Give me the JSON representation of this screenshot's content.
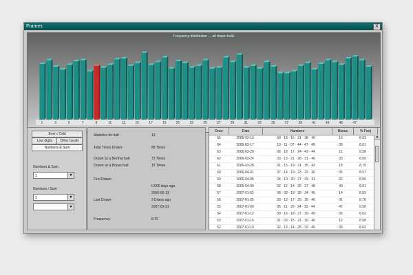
{
  "window": {
    "title": "Frames",
    "close_label": "X"
  },
  "chart_data": {
    "type": "bar",
    "title": "Frequency distribution — all drawn balls",
    "categories": [
      "1",
      "2",
      "3",
      "4",
      "5",
      "6",
      "7",
      "8",
      "9",
      "10",
      "11",
      "12",
      "13",
      "14",
      "15",
      "16",
      "17",
      "18",
      "19",
      "20",
      "21",
      "22",
      "23",
      "24",
      "25",
      "26",
      "27",
      "28",
      "29",
      "30",
      "31",
      "32",
      "33",
      "34",
      "35",
      "36",
      "37",
      "38",
      "39",
      "40",
      "41",
      "42",
      "43",
      "44",
      "45",
      "46",
      "47",
      "48",
      "49"
    ],
    "values": [
      60,
      64,
      57,
      54,
      59,
      63,
      64,
      52,
      58,
      56,
      59,
      65,
      66,
      58,
      61,
      72,
      59,
      62,
      67,
      55,
      63,
      61,
      56,
      58,
      64,
      55,
      56,
      67,
      62,
      70,
      56,
      58,
      55,
      62,
      57,
      50,
      50,
      52,
      58,
      61,
      54,
      60,
      64,
      62,
      59,
      66,
      68,
      64,
      57
    ],
    "highlight_index": 8,
    "highlight_color": "#c92a2a",
    "bar_color": "#1d8f87",
    "ylim": [
      0,
      80
    ],
    "tick_labels": [
      "1",
      "3",
      "5",
      "7",
      "9",
      "11",
      "13",
      "15",
      "17",
      "19",
      "21",
      "23",
      "25",
      "27",
      "29",
      "31",
      "33",
      "35",
      "37",
      "39",
      "41",
      "43",
      "45",
      "47"
    ]
  },
  "left_panel": {
    "mode_tabs": [
      "Even / Odd",
      "Low digits",
      "Other bands"
    ],
    "sub_tab": "Numbers & Sum",
    "group1_label": "Numbers & Sum",
    "group1_value": "1",
    "group2_label": "Numbers / Sum",
    "group2_value": "1",
    "group3_value": ""
  },
  "stats": {
    "rows": [
      {
        "label": "Statistics for ball:",
        "value": "13"
      },
      {
        "label": "Total Times Drawn:",
        "value": "88 Times"
      },
      {
        "label": "Drawn as a Normal ball:",
        "value": "73 Times"
      },
      {
        "label": "Drawn as a Bonus ball:",
        "value": "15 Times"
      },
      {
        "label": "First Drawn:",
        "value": ""
      },
      {
        "label": "",
        "value": "0.000 days ago"
      },
      {
        "label": "",
        "value": "2006-05-13"
      },
      {
        "label": "Last Drawn:",
        "value": "3 Draws ago"
      },
      {
        "label": "",
        "value": "2007-03-31"
      },
      {
        "label": "Frequency:",
        "value": "8.70"
      }
    ]
  },
  "table": {
    "headers": [
      "Draw",
      "Date",
      "Numbers",
      "Bonus",
      "% Freq"
    ],
    "rows": [
      [
        "65",
        "2006-03-13",
        "09 · 18 · 15 · 31 · 38 · 40",
        "13",
        "8.63"
      ],
      [
        "64",
        "2006-03-17",
        "10 · 11 · 07 · 44 · 47 · 49",
        "09",
        "8.61"
      ],
      [
        "63",
        "2006-03-20",
        "06 · 18 · 17 · 24 · 43 · 44",
        "11",
        "8.58"
      ],
      [
        "62",
        "2006-03-24",
        "03 · 13 · 21 · 28 · 31 · 46",
        "30",
        "8.60"
      ],
      [
        "61",
        "2006-03-28",
        "01 · 15 · 19 · 31 · 35 · 42",
        "18",
        "8.70"
      ],
      [
        "60",
        "2006-04-01",
        "07 · 14 · 19 · 23 · 29 · 36",
        "05",
        "8.57"
      ],
      [
        "59",
        "2006-04-05",
        "04 · 10 · 20 · 27 · 33 · 41",
        "22",
        "8.66"
      ],
      [
        "58",
        "2006-04-09",
        "02 · 12 · 14 · 26 · 37 · 48",
        "40",
        "8.61"
      ],
      [
        "57",
        "2007-01-02",
        "08 · 09 · 19 · 28 · 34 · 45",
        "14",
        "8.55"
      ],
      [
        "56",
        "2007-01-05",
        "03 · 13 · 17 · 29 · 35 · 46",
        "01",
        "8.70"
      ],
      [
        "55",
        "2007-01-09",
        "05 · 11 · 20 · 24 · 32 · 44",
        "47",
        "8.50"
      ],
      [
        "54",
        "2007-01-12",
        "09 · 16 · 18 · 27 · 39 · 49",
        "06",
        "8.62"
      ],
      [
        "53",
        "2007-01-16",
        "01 · 03 · 15 · 21 · 30 · 40",
        "12",
        "8.58"
      ],
      [
        "52",
        "2007-01-19",
        "02 · 13 · 14 · 25 · 33 · 45",
        "09",
        "8.62"
      ],
      [
        "51",
        "2007-01-23",
        "04 · 10 · 22 · 24 · 31 · 38",
        "18",
        "8.61"
      ]
    ]
  }
}
